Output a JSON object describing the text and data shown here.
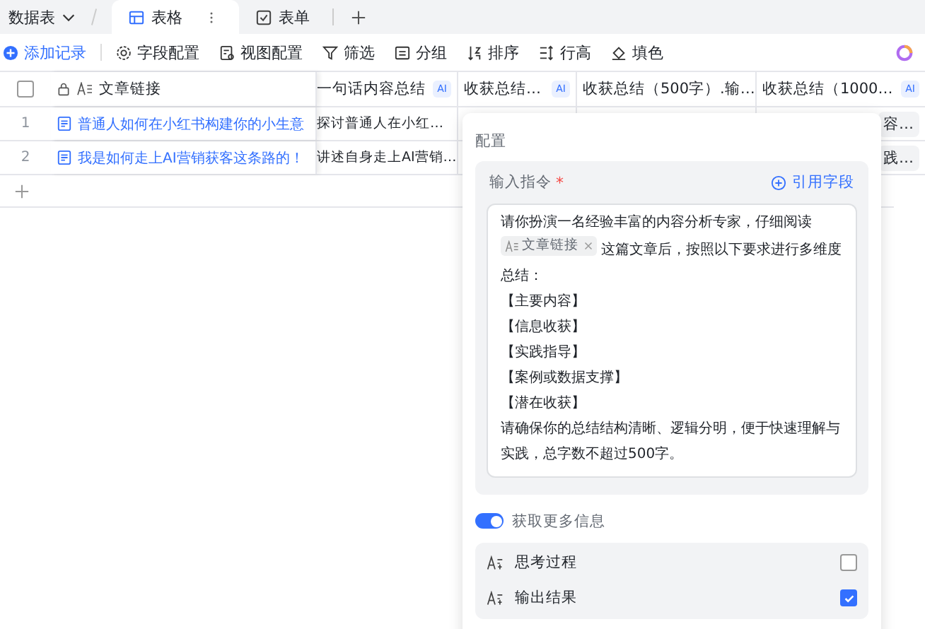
{
  "topbar": {
    "dataset": "数据表",
    "tabs": [
      {
        "label": "表格",
        "kind": "grid",
        "selected": true
      },
      {
        "label": "表单",
        "kind": "form",
        "selected": false
      }
    ]
  },
  "toolbar": {
    "add_button": "添加记录",
    "items": [
      {
        "label": "字段配置",
        "kind": "gear"
      },
      {
        "label": "视图配置",
        "kind": "view"
      },
      {
        "label": "筛选",
        "kind": "filter"
      },
      {
        "label": "分组",
        "kind": "group"
      },
      {
        "label": "排序",
        "kind": "sort"
      },
      {
        "label": "行高",
        "kind": "height"
      },
      {
        "label": "填色",
        "kind": "fill"
      }
    ]
  },
  "table": {
    "select_all_checked": false,
    "columns": [
      {
        "label": "文章链接"
      },
      {
        "label": "一句话内容总结",
        "badge": "AI"
      },
      {
        "label": "收获总结…",
        "badge": "AI"
      },
      {
        "label": "收获总结（500字）.输…"
      },
      {
        "label": "收获总结（1000…",
        "badge": "AI"
      }
    ],
    "rows": [
      {
        "index": "1",
        "article_link": "普通人如何在小红书构建你的小生意",
        "one_line_summary": "探讨普通人在小红…",
        "column_6": "容…"
      },
      {
        "index": "2",
        "article_link": "我是如何走上AI营销获客这条路的！",
        "one_line_summary": "讲述自身走上AI营销…",
        "column_6": "践…"
      }
    ]
  },
  "config_panel": {
    "title": "配置",
    "instruction": {
      "label": "输入指令",
      "required_mark": "*",
      "ref_button": "引用字段",
      "lines": [
        [
          {
            "kind": "text",
            "text": "请你扮演一名经验丰富的内容分析专家，仔细阅读"
          }
        ],
        [
          {
            "kind": "field",
            "text": "文章链接"
          },
          {
            "kind": "text",
            "text": "这篇文章后，按照以下要求进行多维度"
          }
        ],
        [
          {
            "kind": "text",
            "text": "总结："
          }
        ],
        [
          {
            "kind": "text",
            "text": "【主要内容】"
          }
        ],
        [
          {
            "kind": "text",
            "text": "【信息收获】"
          }
        ],
        [
          {
            "kind": "text",
            "text": "【实践指导】"
          }
        ],
        [
          {
            "kind": "text",
            "text": "【案例或数据支撑】"
          }
        ],
        [
          {
            "kind": "text",
            "text": "【潜在收获】"
          }
        ],
        [
          {
            "kind": "text",
            "text": "请确保你的总结结构清晰、逻辑分明，便于快速理解与"
          }
        ],
        [
          {
            "kind": "text",
            "text": "实践，总字数不超过500字。"
          }
        ]
      ]
    },
    "more_info": {
      "label": "获取更多信息",
      "on": true
    },
    "options": [
      {
        "label": "思考过程",
        "checked": false
      },
      {
        "label": "输出结果",
        "checked": true
      }
    ]
  }
}
